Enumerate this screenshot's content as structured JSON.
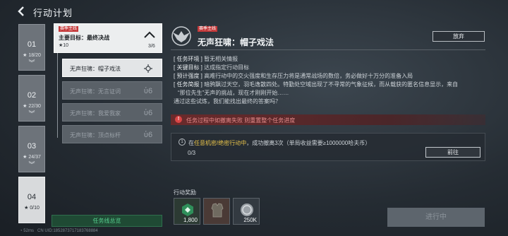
{
  "header": {
    "title": "行动计划"
  },
  "chapters": [
    {
      "num": "01",
      "progress": "★ 18/20"
    },
    {
      "num": "02",
      "progress": "★ 22/30"
    },
    {
      "num": "03",
      "progress": "★ 24/37"
    },
    {
      "num": "04",
      "progress": "★ 0/10"
    }
  ],
  "summary_button": "任务线总览",
  "main_goal": {
    "tag": "赛季主线",
    "title": "主要目标：最终决战",
    "stars": "★10",
    "count": "3/6"
  },
  "tasks": [
    {
      "label": "无声狂啸：帽子戏法"
    },
    {
      "label": "无声狂啸：无言证词"
    },
    {
      "label": "无声狂啸：我爱我家"
    },
    {
      "label": "无声狂啸：顶点标杆"
    }
  ],
  "detail": {
    "tag": "赛季主线",
    "title": "无声狂啸：帽子戏法",
    "abandon": "放弃",
    "info": [
      {
        "label": "[ 任务环境 ]",
        "text": "暂无相关情报"
      },
      {
        "label": "[ 关键目标 ]",
        "text": "达成指定行动目标"
      },
      {
        "label": "[ 预计强度 ]",
        "text": "高难行动中的交火强度和生存压力将是通常战场的数倍，务必做好十万分的准备入局"
      },
      {
        "label": "[ 任务简报 ]",
        "text": "暗鸦飘过天空，羽毛逸散四处。特勤处空域出现了不寻常的气象征候，而从载获的匿名信息显示，来自"
      }
    ],
    "brief_cont_1": "“那位先生”无声的挑战，现在才刚刚开始……",
    "brief_cont_2": "通过这些试炼，我们能找出最终的答案吗？",
    "warning": "任务过程中如撤离失败 则重置整个任务进度",
    "objective": {
      "num": "1",
      "prefix": "在",
      "highlight": "任意机密/绝密行动中",
      "suffix": "，成功撤离3次（单局收益需要≥1000000哈夫币）",
      "progress": "0/3",
      "goto": "前往"
    },
    "rewards_label": "行动奖励",
    "rewards": [
      {
        "value": "1,800",
        "icon": "currency-icon",
        "color": "#2f8f5a"
      },
      {
        "value": "",
        "icon": "armor-icon",
        "color": "#6f6a60"
      },
      {
        "value": "250K",
        "icon": "coin-icon",
        "color": "#9aa0a6"
      }
    ],
    "proceed": "进行中"
  },
  "status_bar": {
    "fps": "52ms",
    "uid": "CN UID:1852873717183768884"
  }
}
